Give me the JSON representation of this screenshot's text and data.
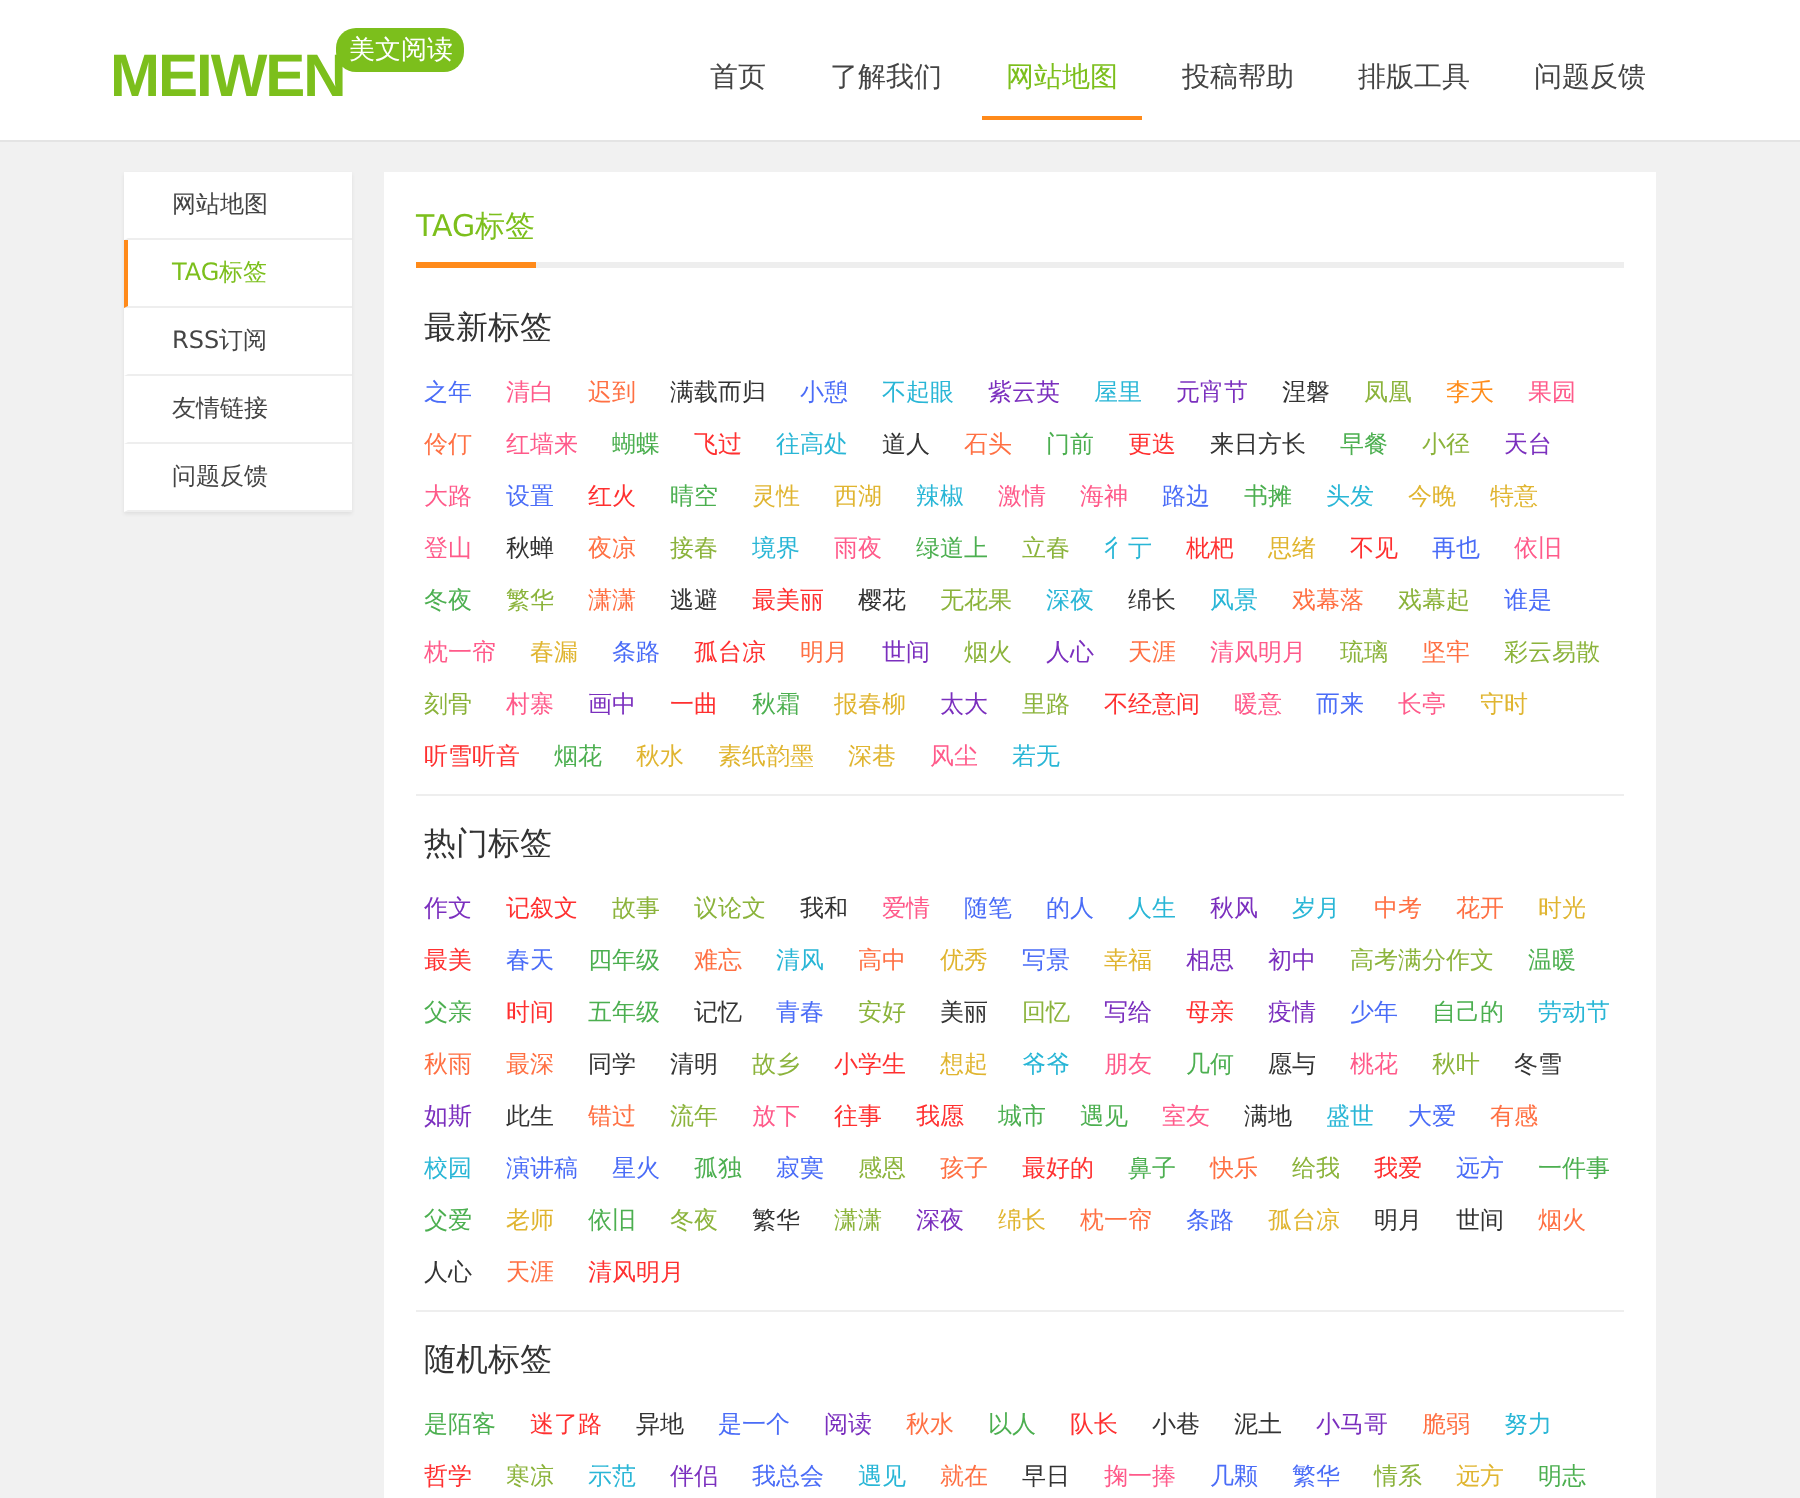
{
  "logo": {
    "text": "MEIWEN",
    "badge": "美文阅读"
  },
  "nav": [
    {
      "label": "首页",
      "selected": false
    },
    {
      "label": "了解我们",
      "selected": false
    },
    {
      "label": "网站地图",
      "selected": true
    },
    {
      "label": "投稿帮助",
      "selected": false
    },
    {
      "label": "排版工具",
      "selected": false
    },
    {
      "label": "问题反馈",
      "selected": false
    }
  ],
  "sidebar": {
    "items": [
      {
        "label": "网站地图",
        "selected": false
      },
      {
        "label": "TAG标签",
        "selected": true
      },
      {
        "label": "RSS订阅",
        "selected": false
      },
      {
        "label": "友情链接",
        "selected": false
      },
      {
        "label": "问题反馈",
        "selected": false
      }
    ]
  },
  "panel_title": "TAG标签",
  "sections": [
    {
      "title": "最新标签",
      "tags": [
        {
          "label": "之年",
          "color": "#4a6cf7"
        },
        {
          "label": "清白",
          "color": "#ff5a8a"
        },
        {
          "label": "迟到",
          "color": "#ff7043"
        },
        {
          "label": "满载而归",
          "color": "#333333"
        },
        {
          "label": "小憩",
          "color": "#4a6cf7"
        },
        {
          "label": "不起眼",
          "color": "#29b6d6"
        },
        {
          "label": "紫云英",
          "color": "#7b2fbe"
        },
        {
          "label": "屋里",
          "color": "#29b6d6"
        },
        {
          "label": "元宵节",
          "color": "#7b2fbe"
        },
        {
          "label": "涅磐",
          "color": "#333333"
        },
        {
          "label": "凤凰",
          "color": "#8bb33b"
        },
        {
          "label": "李夭",
          "color": "#ff8c1a"
        },
        {
          "label": "果园",
          "color": "#ff5a8a"
        },
        {
          "label": "伶仃",
          "color": "#ff7043"
        },
        {
          "label": "红墙来",
          "color": "#ff5a8a"
        },
        {
          "label": "蝴蝶",
          "color": "#4caf50"
        },
        {
          "label": "飞过",
          "color": "#ff3030"
        },
        {
          "label": "往高处",
          "color": "#29b6d6"
        },
        {
          "label": "道人",
          "color": "#333333"
        },
        {
          "label": "石头",
          "color": "#ff7043"
        },
        {
          "label": "门前",
          "color": "#4caf50"
        },
        {
          "label": "更迭",
          "color": "#ff3030"
        },
        {
          "label": "来日方长",
          "color": "#333333"
        },
        {
          "label": "早餐",
          "color": "#4caf50"
        },
        {
          "label": "小径",
          "color": "#8bb33b"
        },
        {
          "label": "天台",
          "color": "#7b2fbe"
        },
        {
          "label": "大路",
          "color": "#ff5a8a"
        },
        {
          "label": "设置",
          "color": "#4a6cf7"
        },
        {
          "label": "红火",
          "color": "#ff3030"
        },
        {
          "label": "晴空",
          "color": "#4caf50"
        },
        {
          "label": "灵性",
          "color": "#e0b530"
        },
        {
          "label": "西湖",
          "color": "#e0b530"
        },
        {
          "label": "辣椒",
          "color": "#29b6d6"
        },
        {
          "label": "激情",
          "color": "#ff5a8a"
        },
        {
          "label": "海神",
          "color": "#ff5a8a"
        },
        {
          "label": "路边",
          "color": "#4a6cf7"
        },
        {
          "label": "书摊",
          "color": "#4caf50"
        },
        {
          "label": "头发",
          "color": "#29b6d6"
        },
        {
          "label": "今晚",
          "color": "#e0b530"
        },
        {
          "label": "特意",
          "color": "#e0b530"
        },
        {
          "label": "登山",
          "color": "#ff5a8a"
        },
        {
          "label": "秋蝉",
          "color": "#333333"
        },
        {
          "label": "夜凉",
          "color": "#ff7043"
        },
        {
          "label": "接春",
          "color": "#8bb33b"
        },
        {
          "label": "境界",
          "color": "#29b6d6"
        },
        {
          "label": "雨夜",
          "color": "#ff5a8a"
        },
        {
          "label": "绿道上",
          "color": "#4caf50"
        },
        {
          "label": "立春",
          "color": "#8bb33b"
        },
        {
          "label": "彳亍",
          "color": "#29b6d6"
        },
        {
          "label": "枇杷",
          "color": "#ff3030"
        },
        {
          "label": "思绪",
          "color": "#e0b530"
        },
        {
          "label": "不见",
          "color": "#ff3030"
        },
        {
          "label": "再也",
          "color": "#4a6cf7"
        },
        {
          "label": "依旧",
          "color": "#ff5a8a"
        },
        {
          "label": "冬夜",
          "color": "#4caf50"
        },
        {
          "label": "繁华",
          "color": "#8bb33b"
        },
        {
          "label": "潇潇",
          "color": "#ff7043"
        },
        {
          "label": "逃避",
          "color": "#333333"
        },
        {
          "label": "最美丽",
          "color": "#ff3030"
        },
        {
          "label": "樱花",
          "color": "#333333"
        },
        {
          "label": "无花果",
          "color": "#8bb33b"
        },
        {
          "label": "深夜",
          "color": "#29b6d6"
        },
        {
          "label": "绵长",
          "color": "#333333"
        },
        {
          "label": "风景",
          "color": "#29b6d6"
        },
        {
          "label": "戏幕落",
          "color": "#ff7043"
        },
        {
          "label": "戏幕起",
          "color": "#8bb33b"
        },
        {
          "label": "谁是",
          "color": "#4a6cf7"
        },
        {
          "label": "枕一帘",
          "color": "#ff5a8a"
        },
        {
          "label": "春漏",
          "color": "#e0b530"
        },
        {
          "label": "条路",
          "color": "#4a6cf7"
        },
        {
          "label": "孤台凉",
          "color": "#ff3030"
        },
        {
          "label": "明月",
          "color": "#ff7043"
        },
        {
          "label": "世间",
          "color": "#7b2fbe"
        },
        {
          "label": "烟火",
          "color": "#8bb33b"
        },
        {
          "label": "人心",
          "color": "#7b2fbe"
        },
        {
          "label": "天涯",
          "color": "#ff7043"
        },
        {
          "label": "清风明月",
          "color": "#ff5a8a"
        },
        {
          "label": "琉璃",
          "color": "#8bb33b"
        },
        {
          "label": "坚牢",
          "color": "#ff7043"
        },
        {
          "label": "彩云易散",
          "color": "#8bb33b"
        },
        {
          "label": "刻骨",
          "color": "#8bb33b"
        },
        {
          "label": "村寨",
          "color": "#ff5a8a"
        },
        {
          "label": "画中",
          "color": "#7b2fbe"
        },
        {
          "label": "一曲",
          "color": "#ff3030"
        },
        {
          "label": "秋霜",
          "color": "#4caf50"
        },
        {
          "label": "报春柳",
          "color": "#e0b530"
        },
        {
          "label": "太大",
          "color": "#7b2fbe"
        },
        {
          "label": "里路",
          "color": "#8bb33b"
        },
        {
          "label": "不经意间",
          "color": "#ff3030"
        },
        {
          "label": "暖意",
          "color": "#ff5a8a"
        },
        {
          "label": "而来",
          "color": "#4a6cf7"
        },
        {
          "label": "长亭",
          "color": "#ff5a8a"
        },
        {
          "label": "守时",
          "color": "#e0b530"
        },
        {
          "label": "听雪听音",
          "color": "#ff3030"
        },
        {
          "label": "烟花",
          "color": "#4caf50"
        },
        {
          "label": "秋水",
          "color": "#e0b530"
        },
        {
          "label": "素纸韵墨",
          "color": "#e0b530"
        },
        {
          "label": "深巷",
          "color": "#e0b530"
        },
        {
          "label": "风尘",
          "color": "#ff5a8a"
        },
        {
          "label": "若无",
          "color": "#29b6d6"
        }
      ]
    },
    {
      "title": "热门标签",
      "tags": [
        {
          "label": "作文",
          "color": "#7b2fbe"
        },
        {
          "label": "记叙文",
          "color": "#ff3030"
        },
        {
          "label": "故事",
          "color": "#8bb33b"
        },
        {
          "label": "议论文",
          "color": "#8bb33b"
        },
        {
          "label": "我和",
          "color": "#333333"
        },
        {
          "label": "爱情",
          "color": "#ff5a8a"
        },
        {
          "label": "随笔",
          "color": "#4a6cf7"
        },
        {
          "label": "的人",
          "color": "#4a6cf7"
        },
        {
          "label": "人生",
          "color": "#29b6d6"
        },
        {
          "label": "秋风",
          "color": "#7b2fbe"
        },
        {
          "label": "岁月",
          "color": "#29b6d6"
        },
        {
          "label": "中考",
          "color": "#ff7043"
        },
        {
          "label": "花开",
          "color": "#ff7043"
        },
        {
          "label": "时光",
          "color": "#e0b530"
        },
        {
          "label": "最美",
          "color": "#ff3030"
        },
        {
          "label": "春天",
          "color": "#4a6cf7"
        },
        {
          "label": "四年级",
          "color": "#4caf50"
        },
        {
          "label": "难忘",
          "color": "#ff7043"
        },
        {
          "label": "清风",
          "color": "#29b6d6"
        },
        {
          "label": "高中",
          "color": "#ff7043"
        },
        {
          "label": "优秀",
          "color": "#e0b530"
        },
        {
          "label": "写景",
          "color": "#4a6cf7"
        },
        {
          "label": "幸福",
          "color": "#e0b530"
        },
        {
          "label": "相思",
          "color": "#7b2fbe"
        },
        {
          "label": "初中",
          "color": "#7b2fbe"
        },
        {
          "label": "高考满分作文",
          "color": "#8bb33b"
        },
        {
          "label": "温暖",
          "color": "#4caf50"
        },
        {
          "label": "父亲",
          "color": "#4caf50"
        },
        {
          "label": "时间",
          "color": "#ff3030"
        },
        {
          "label": "五年级",
          "color": "#4caf50"
        },
        {
          "label": "记忆",
          "color": "#333333"
        },
        {
          "label": "青春",
          "color": "#4a6cf7"
        },
        {
          "label": "安好",
          "color": "#8bb33b"
        },
        {
          "label": "美丽",
          "color": "#333333"
        },
        {
          "label": "回忆",
          "color": "#8bb33b"
        },
        {
          "label": "写给",
          "color": "#7b2fbe"
        },
        {
          "label": "母亲",
          "color": "#ff3030"
        },
        {
          "label": "疫情",
          "color": "#7b2fbe"
        },
        {
          "label": "少年",
          "color": "#4a6cf7"
        },
        {
          "label": "自己的",
          "color": "#4caf50"
        },
        {
          "label": "劳动节",
          "color": "#29b6d6"
        },
        {
          "label": "秋雨",
          "color": "#ff7043"
        },
        {
          "label": "最深",
          "color": "#ff7043"
        },
        {
          "label": "同学",
          "color": "#333333"
        },
        {
          "label": "清明",
          "color": "#333333"
        },
        {
          "label": "故乡",
          "color": "#8bb33b"
        },
        {
          "label": "小学生",
          "color": "#ff3030"
        },
        {
          "label": "想起",
          "color": "#e0b530"
        },
        {
          "label": "爷爷",
          "color": "#29b6d6"
        },
        {
          "label": "朋友",
          "color": "#ff5a8a"
        },
        {
          "label": "几何",
          "color": "#4caf50"
        },
        {
          "label": "愿与",
          "color": "#333333"
        },
        {
          "label": "桃花",
          "color": "#ff5a8a"
        },
        {
          "label": "秋叶",
          "color": "#8bb33b"
        },
        {
          "label": "冬雪",
          "color": "#333333"
        },
        {
          "label": "如斯",
          "color": "#7b2fbe"
        },
        {
          "label": "此生",
          "color": "#333333"
        },
        {
          "label": "错过",
          "color": "#ff7043"
        },
        {
          "label": "流年",
          "color": "#8bb33b"
        },
        {
          "label": "放下",
          "color": "#ff5a8a"
        },
        {
          "label": "往事",
          "color": "#ff3030"
        },
        {
          "label": "我愿",
          "color": "#ff3030"
        },
        {
          "label": "城市",
          "color": "#4caf50"
        },
        {
          "label": "遇见",
          "color": "#4caf50"
        },
        {
          "label": "室友",
          "color": "#ff5a8a"
        },
        {
          "label": "满地",
          "color": "#333333"
        },
        {
          "label": "盛世",
          "color": "#29b6d6"
        },
        {
          "label": "大爱",
          "color": "#4a6cf7"
        },
        {
          "label": "有感",
          "color": "#ff7043"
        },
        {
          "label": "校园",
          "color": "#29b6d6"
        },
        {
          "label": "演讲稿",
          "color": "#4a6cf7"
        },
        {
          "label": "星火",
          "color": "#4a6cf7"
        },
        {
          "label": "孤独",
          "color": "#4caf50"
        },
        {
          "label": "寂寞",
          "color": "#4a6cf7"
        },
        {
          "label": "感恩",
          "color": "#8bb33b"
        },
        {
          "label": "孩子",
          "color": "#ff7043"
        },
        {
          "label": "最好的",
          "color": "#ff3030"
        },
        {
          "label": "鼻子",
          "color": "#4caf50"
        },
        {
          "label": "快乐",
          "color": "#ff7043"
        },
        {
          "label": "给我",
          "color": "#8bb33b"
        },
        {
          "label": "我爱",
          "color": "#ff3030"
        },
        {
          "label": "远方",
          "color": "#4a6cf7"
        },
        {
          "label": "一件事",
          "color": "#4caf50"
        },
        {
          "label": "父爱",
          "color": "#4caf50"
        },
        {
          "label": "老师",
          "color": "#e0b530"
        },
        {
          "label": "依旧",
          "color": "#4caf50"
        },
        {
          "label": "冬夜",
          "color": "#8bb33b"
        },
        {
          "label": "繁华",
          "color": "#333333"
        },
        {
          "label": "潇潇",
          "color": "#8bb33b"
        },
        {
          "label": "深夜",
          "color": "#7b2fbe"
        },
        {
          "label": "绵长",
          "color": "#e0b530"
        },
        {
          "label": "枕一帘",
          "color": "#ff7043"
        },
        {
          "label": "条路",
          "color": "#4a6cf7"
        },
        {
          "label": "孤台凉",
          "color": "#e0b530"
        },
        {
          "label": "明月",
          "color": "#333333"
        },
        {
          "label": "世间",
          "color": "#333333"
        },
        {
          "label": "烟火",
          "color": "#ff7043"
        },
        {
          "label": "人心",
          "color": "#333333"
        },
        {
          "label": "天涯",
          "color": "#ff7043"
        },
        {
          "label": "清风明月",
          "color": "#ff3030"
        }
      ]
    },
    {
      "title": "随机标签",
      "tags": [
        {
          "label": "是陌客",
          "color": "#4caf50"
        },
        {
          "label": "迷了路",
          "color": "#ff3030"
        },
        {
          "label": "异地",
          "color": "#333333"
        },
        {
          "label": "是一个",
          "color": "#4a6cf7"
        },
        {
          "label": "阅读",
          "color": "#7b2fbe"
        },
        {
          "label": "秋水",
          "color": "#ff7043"
        },
        {
          "label": "以人",
          "color": "#4caf50"
        },
        {
          "label": "队长",
          "color": "#ff3030"
        },
        {
          "label": "小巷",
          "color": "#333333"
        },
        {
          "label": "泥土",
          "color": "#333333"
        },
        {
          "label": "小马哥",
          "color": "#7b2fbe"
        },
        {
          "label": "脆弱",
          "color": "#ff7043"
        },
        {
          "label": "努力",
          "color": "#29b6d6"
        },
        {
          "label": "哲学",
          "color": "#ff3030"
        },
        {
          "label": "寒凉",
          "color": "#8bb33b"
        },
        {
          "label": "示范",
          "color": "#29b6d6"
        },
        {
          "label": "伴侣",
          "color": "#7b2fbe"
        },
        {
          "label": "我总会",
          "color": "#4a6cf7"
        },
        {
          "label": "遇见",
          "color": "#29b6d6"
        },
        {
          "label": "就在",
          "color": "#ff7043"
        },
        {
          "label": "早日",
          "color": "#333333"
        },
        {
          "label": "掬一捧",
          "color": "#ff5a8a"
        },
        {
          "label": "几颗",
          "color": "#4a6cf7"
        },
        {
          "label": "繁华",
          "color": "#4a6cf7"
        },
        {
          "label": "情系",
          "color": "#8bb33b"
        },
        {
          "label": "远方",
          "color": "#e0b530"
        },
        {
          "label": "明志",
          "color": "#4caf50"
        }
      ]
    }
  ]
}
